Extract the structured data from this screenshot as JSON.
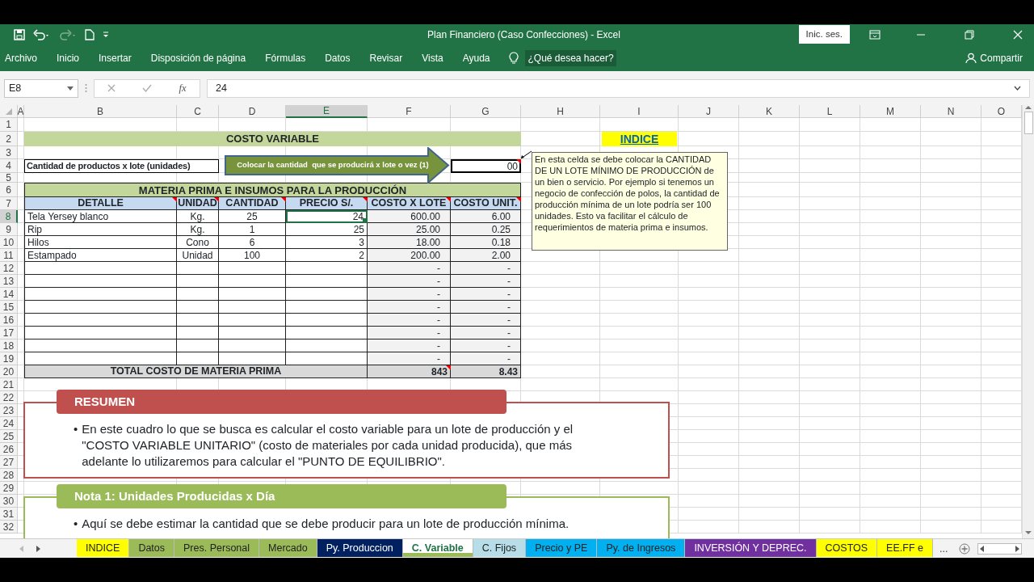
{
  "window": {
    "title": "Plan Financiero (Caso Confecciones)  -  Excel",
    "sign_in": "Inic. ses."
  },
  "ribbon": {
    "tabs": [
      "Archivo",
      "Inicio",
      "Insertar",
      "Disposición de página",
      "Fórmulas",
      "Datos",
      "Revisar",
      "Vista",
      "Ayuda"
    ],
    "tell_me": "¿Qué desea hacer?",
    "share": "Compartir"
  },
  "formula_bar": {
    "name_box": "E8",
    "function_button": "fx",
    "value": "24"
  },
  "columns": [
    {
      "label": "A",
      "selected": false
    },
    {
      "label": "B",
      "selected": false
    },
    {
      "label": "C",
      "selected": false
    },
    {
      "label": "D",
      "selected": false
    },
    {
      "label": "E",
      "selected": true
    },
    {
      "label": "F",
      "selected": false
    },
    {
      "label": "G",
      "selected": false
    },
    {
      "label": "H",
      "selected": false
    },
    {
      "label": "I",
      "selected": false
    },
    {
      "label": "J",
      "selected": false
    },
    {
      "label": "K",
      "selected": false
    },
    {
      "label": "L",
      "selected": false
    },
    {
      "label": "M",
      "selected": false
    },
    {
      "label": "N",
      "selected": false
    },
    {
      "label": "O",
      "selected": false
    }
  ],
  "rows": [
    {
      "label": "1",
      "selected": false
    },
    {
      "label": "2",
      "selected": false
    },
    {
      "label": "3",
      "selected": false
    },
    {
      "label": "4",
      "selected": false
    },
    {
      "label": "5",
      "selected": false
    },
    {
      "label": "6",
      "selected": false
    },
    {
      "label": "7",
      "selected": false
    },
    {
      "label": "8",
      "selected": true
    },
    {
      "label": "9",
      "selected": false
    },
    {
      "label": "10",
      "selected": false
    },
    {
      "label": "11",
      "selected": false
    },
    {
      "label": "12",
      "selected": false
    },
    {
      "label": "13",
      "selected": false
    },
    {
      "label": "14",
      "selected": false
    },
    {
      "label": "15",
      "selected": false
    },
    {
      "label": "16",
      "selected": false
    },
    {
      "label": "17",
      "selected": false
    },
    {
      "label": "18",
      "selected": false
    },
    {
      "label": "19",
      "selected": false
    },
    {
      "label": "20",
      "selected": false
    },
    {
      "label": "21",
      "selected": false
    },
    {
      "label": "22",
      "selected": false
    },
    {
      "label": "23",
      "selected": false
    },
    {
      "label": "24",
      "selected": false
    },
    {
      "label": "25",
      "selected": false
    },
    {
      "label": "26",
      "selected": false
    },
    {
      "label": "27",
      "selected": false
    },
    {
      "label": "28",
      "selected": false
    },
    {
      "label": "29",
      "selected": false
    },
    {
      "label": "30",
      "selected": false
    },
    {
      "label": "31",
      "selected": false
    },
    {
      "label": "32",
      "selected": false
    }
  ],
  "sheet": {
    "title": "COSTO VARIABLE",
    "quantity": {
      "label": "Cantidad de productos x lote (unidades)",
      "value": "00",
      "comment": true
    },
    "callout": "Colocar la cantidad  que se producirá x lote o vez (1)",
    "indice_link": "INDICE",
    "comment_box": "En esta celda se debe colocar la CANTIDAD DE UN LOTE MÍNIMO DE PRODUCCIÓN de un bien o servicio. Por ejemplo si tenemos un negocio de confección de polos, la cantidad de producción mínima de un lote podría ser 100 unidades. Esto va facilitar el cálculo de requerimientos de materia prima e insumos.",
    "table": {
      "title": "MATERIA PRIMA E INSUMOS PARA LA PRODUCCIÓN",
      "columns": [
        {
          "label": "DETALLE",
          "comment": true
        },
        {
          "label": "UNIDAD",
          "comment": true
        },
        {
          "label": "CANTIDAD",
          "comment": true
        },
        {
          "label": "PRECIO S/.",
          "comment": true
        },
        {
          "label": "COSTO X LOTE",
          "comment": true
        },
        {
          "label": "COSTO UNIT.",
          "comment": true
        }
      ],
      "rows": [
        {
          "detalle": "Tela Yersey blanco",
          "unidad": "Kg.",
          "cantidad": "25",
          "precio": "24",
          "costo_x_lote": "600.00",
          "costo_unit": "6.00"
        },
        {
          "detalle": "Rip",
          "unidad": "Kg.",
          "cantidad": "1",
          "precio": "25",
          "costo_x_lote": "25.00",
          "costo_unit": "0.25"
        },
        {
          "detalle": "Hilos",
          "unidad": "Cono",
          "cantidad": "6",
          "precio": "3",
          "costo_x_lote": "18.00",
          "costo_unit": "0.18"
        },
        {
          "detalle": "Estampado",
          "unidad": "Unidad",
          "cantidad": "100",
          "precio": "2",
          "costo_x_lote": "200.00",
          "costo_unit": "2.00"
        },
        {
          "costo_x_lote": "-",
          "costo_unit": "-"
        },
        {
          "costo_x_lote": "-",
          "costo_unit": "-"
        },
        {
          "costo_x_lote": "-",
          "costo_unit": "-"
        },
        {
          "costo_x_lote": "-",
          "costo_unit": "-"
        },
        {
          "costo_x_lote": "-",
          "costo_unit": "-"
        },
        {
          "costo_x_lote": "-",
          "costo_unit": "-"
        },
        {
          "costo_x_lote": "-",
          "costo_unit": "-"
        },
        {
          "costo_x_lote": "-",
          "costo_unit": "-"
        }
      ],
      "total": {
        "label": "TOTAL COSTO DE MATERIA PRIMA",
        "costo_x_lote": "843",
        "costo_unit": "8.43",
        "comment": true
      }
    },
    "notes": [
      {
        "title": "RESUMEN",
        "color": "#c0504d",
        "bullet": "•",
        "text": "En este cuadro lo que se busca es calcular el costo variable para un lote de producción y el \"COSTO VARIABLE UNITARIO\" (costo de materiales por cada unidad producida), que más adelante lo utilizaremos para calcular el \"PUNTO DE EQUILIBRIO\"."
      },
      {
        "title": "Nota 1: Unidades Producidas x Día",
        "color": "#9bbb59",
        "bullet": "•",
        "text": "Aquí se debe estimar la cantidad que se debe producir para un lote de producción mínima."
      }
    ]
  },
  "sheet_tabs": [
    {
      "label": "INDICE",
      "color": "#ffff00",
      "selected": false
    },
    {
      "label": "Datos",
      "color": "#9bbb59",
      "selected": false
    },
    {
      "label": "Pres. Personal",
      "color": "#9bbb59",
      "selected": false
    },
    {
      "label": "Mercado",
      "color": "#9bbb59",
      "selected": false
    },
    {
      "label": "Py. Produccion",
      "color": "#002060",
      "selected": false
    },
    {
      "label": "C. Variable",
      "color": "#9bbb59",
      "selected": true
    },
    {
      "label": "C. Fijos",
      "color": "#b7dee8",
      "selected": false
    },
    {
      "label": "Precio y PE",
      "color": "#00b0f0",
      "selected": false
    },
    {
      "label": "Py. de Ingresos",
      "color": "#00b0f0",
      "selected": false
    },
    {
      "label": "INVERSIÓN Y DEPREC.",
      "color": "#7030a0",
      "selected": false
    },
    {
      "label": "COSTOS",
      "color": "#ffff00",
      "selected": false
    },
    {
      "label": "EE.FF  e",
      "color": "#ffff00",
      "selected": false
    }
  ],
  "more_tabs": "..."
}
